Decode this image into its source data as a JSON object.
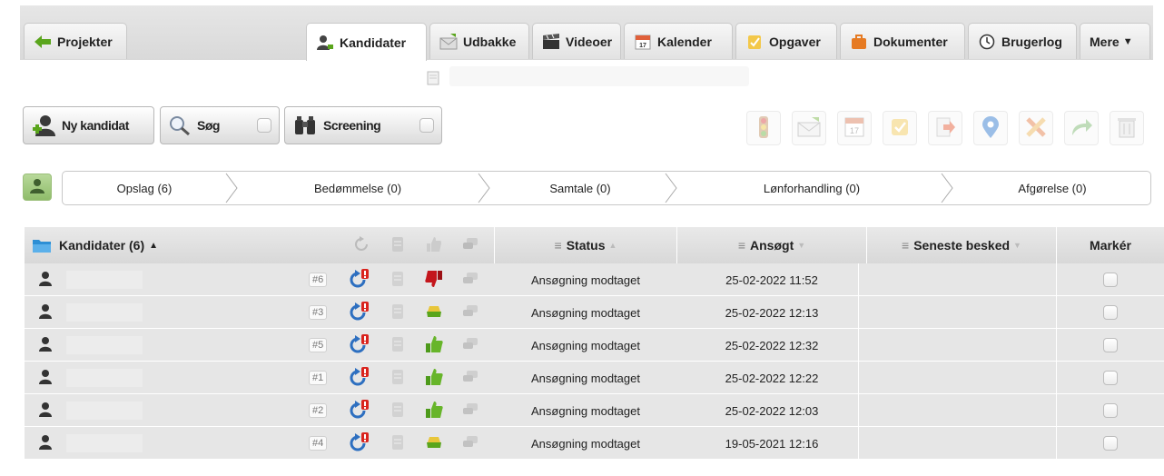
{
  "tabs": {
    "projects": "Projekter",
    "candidates": "Kandidater",
    "outbox": "Udbakke",
    "videos": "Videoer",
    "calendar": "Kalender",
    "tasks": "Opgaver",
    "documents": "Dokumenter",
    "userlog": "Brugerlog",
    "more": "Mere"
  },
  "toolbar": {
    "new_candidate": "Ny kandidat",
    "search": "Søg",
    "screening": "Screening"
  },
  "pipeline": [
    {
      "label": "Opslag (6)"
    },
    {
      "label": "Bedømmelse (0)"
    },
    {
      "label": "Samtale (0)"
    },
    {
      "label": "Lønforhandling (0)"
    },
    {
      "label": "Afgørelse (0)"
    }
  ],
  "table": {
    "headers": {
      "candidates": "Kandidater (6)",
      "status": "Status",
      "applied": "Ansøgt",
      "last_message": "Seneste besked",
      "mark": "Markér"
    },
    "rows": [
      {
        "num": "#6",
        "rating": "down",
        "status": "Ansøgning modtaget",
        "applied": "25-02-2022 11:52"
      },
      {
        "num": "#3",
        "rating": "neutral",
        "status": "Ansøgning modtaget",
        "applied": "25-02-2022 12:13"
      },
      {
        "num": "#5",
        "rating": "up",
        "status": "Ansøgning modtaget",
        "applied": "25-02-2022 12:32"
      },
      {
        "num": "#1",
        "rating": "up",
        "status": "Ansøgning modtaget",
        "applied": "25-02-2022 12:22"
      },
      {
        "num": "#2",
        "rating": "up",
        "status": "Ansøgning modtaget",
        "applied": "25-02-2022 12:03"
      },
      {
        "num": "#4",
        "rating": "neutral",
        "status": "Ansøgning modtaget",
        "applied": "19-05-2021 12:16"
      }
    ]
  },
  "colors": {
    "accent_blue": "#2d6fc0",
    "alert_red": "#d9231d",
    "thumb_green": "#5aa51c",
    "thumb_red": "#c4161c",
    "row_bg": "#e6e6e6"
  }
}
